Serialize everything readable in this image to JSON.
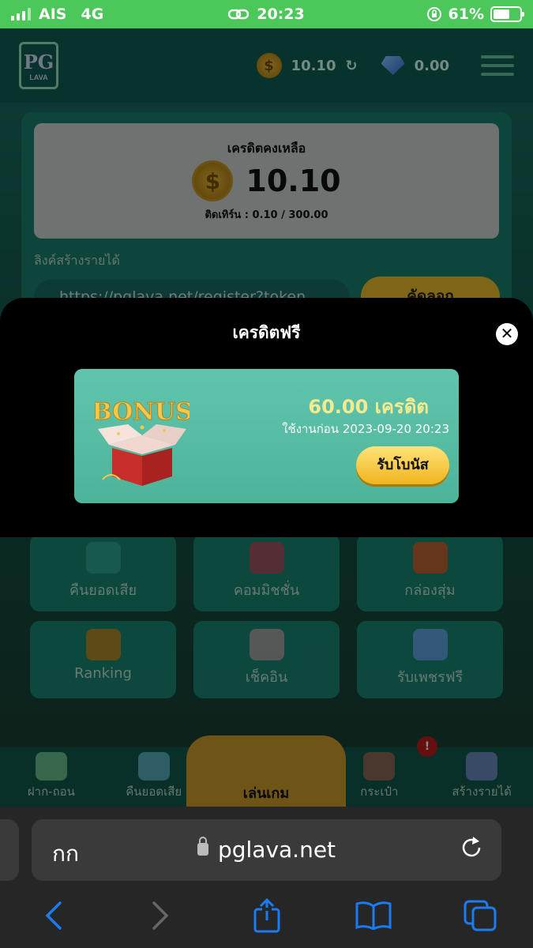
{
  "status_bar": {
    "carrier": "AIS",
    "network": "4G",
    "time": "20:23",
    "battery": "61%",
    "battery_level": 0.61
  },
  "header": {
    "logo_big": "PG",
    "logo_small": "LAVA",
    "coin_symbol": "$",
    "coin_balance": "10.10",
    "refresh_icon": "↻",
    "gem_balance": "0.00"
  },
  "credit": {
    "title": "เครดิตคงเหลือ",
    "coin_symbol": "$",
    "value": "10.10",
    "turnover": "ติดเทิร์น : 0.10 / 300.00"
  },
  "referral": {
    "label": "ลิงค์สร้างรายได้",
    "link": "https://pglava.net/register?token",
    "copy_label": "คัดลอก"
  },
  "tiles": [
    {
      "label": "คืนยอดเสีย"
    },
    {
      "label": "คอมมิชชั่น"
    },
    {
      "label": "กล่องสุ่ม"
    },
    {
      "label": "Ranking"
    },
    {
      "label": "เช็คอิน"
    },
    {
      "label": "รับเพชรฟรี"
    }
  ],
  "bottom_nav": {
    "deposit": "ฝาก-ถอน",
    "cashback": "คืนยอดเสีย",
    "play": "เล่นเกม",
    "wallet": "กระเป๋า",
    "affiliate": "สร้างรายได้",
    "badge": "!"
  },
  "modal": {
    "title": "เครดิตฟรี",
    "close": "✕",
    "bonus_text": "BONUS",
    "amount": "60.00 เครดิต",
    "expiry": "ใช้งานก่อน 2023-09-20 20:23",
    "claim_label": "รับโบนัส"
  },
  "browser": {
    "text_size": "กก",
    "url": "pglava.net"
  },
  "icons": {
    "back": "chevron-left-icon",
    "forward": "chevron-right-icon",
    "share": "share-icon",
    "bookmarks": "book-icon",
    "tabs": "tabs-icon"
  },
  "colors": {
    "accent_green": "#4cc75a",
    "ios_blue": "#1a7cf5",
    "bonus_card": "#5bbfa6",
    "gold": "#f0b51d"
  }
}
